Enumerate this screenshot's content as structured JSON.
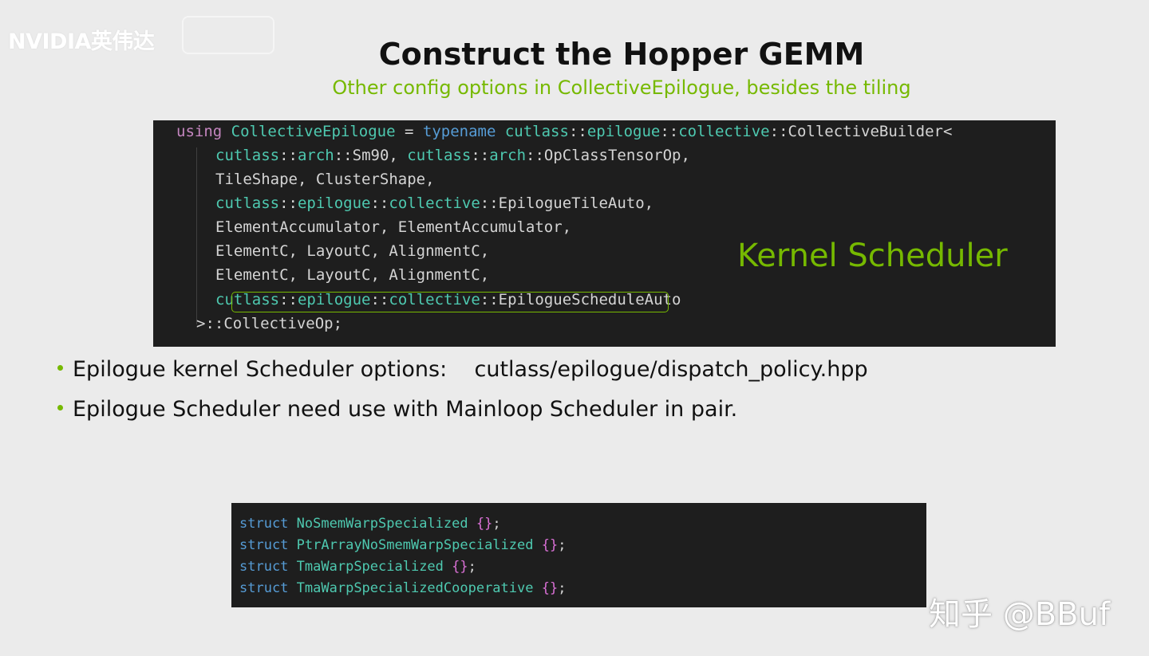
{
  "watermarks": {
    "top_left": "NVIDIA英伟达",
    "bottom_right": "知乎 @BBuf"
  },
  "slide": {
    "title": "Construct the Hopper GEMM",
    "subtitle": "Other config options in CollectiveEpilogue, besides the tiling"
  },
  "code_main": {
    "line1": {
      "using": "using",
      "name": "CollectiveEpilogue",
      "eq": " = ",
      "typename": "typename",
      "ns1": "cutlass",
      "sep": "::",
      "ns2": "epilogue",
      "ns3": "collective",
      "rest": "CollectiveBuilder<"
    },
    "line2": {
      "ns": "cutlass",
      "arch": "arch",
      "t1": "Sm90",
      "t2": "OpClassTensorOp"
    },
    "line3": "TileShape, ClusterShape,",
    "line4": {
      "ns": "cutlass",
      "ns2": "epilogue",
      "ns3": "collective",
      "t": "EpilogueTileAuto,"
    },
    "line5": "ElementAccumulator, ElementAccumulator,",
    "line6": "ElementC, LayoutC, AlignmentC,",
    "line7": "ElementC, LayoutC, AlignmentC,",
    "line8": {
      "ns": "cutlass",
      "ns2": "epilogue",
      "ns3": "collective",
      "t": "EpilogueScheduleAuto"
    },
    "line9": ">::CollectiveOp;"
  },
  "kernel_label": "Kernel Scheduler",
  "bullets": [
    {
      "text": "Epilogue kernel Scheduler options:    cutlass/epilogue/dispatch_policy.hpp"
    },
    {
      "text": "Epilogue Scheduler need use with Mainloop Scheduler in pair."
    }
  ],
  "code_structs": [
    {
      "kw": "struct",
      "name": "NoSmemWarpSpecialized",
      "tail": ";"
    },
    {
      "kw": "struct",
      "name": "PtrArrayNoSmemWarpSpecialized",
      "tail": ";"
    },
    {
      "kw": "struct",
      "name": "TmaWarpSpecialized",
      "tail": ";"
    },
    {
      "kw": "struct",
      "name": "TmaWarpSpecializedCooperative",
      "tail": ";"
    }
  ],
  "colors": {
    "accent_green": "#76b900",
    "code_bg": "#1e1e1e"
  }
}
